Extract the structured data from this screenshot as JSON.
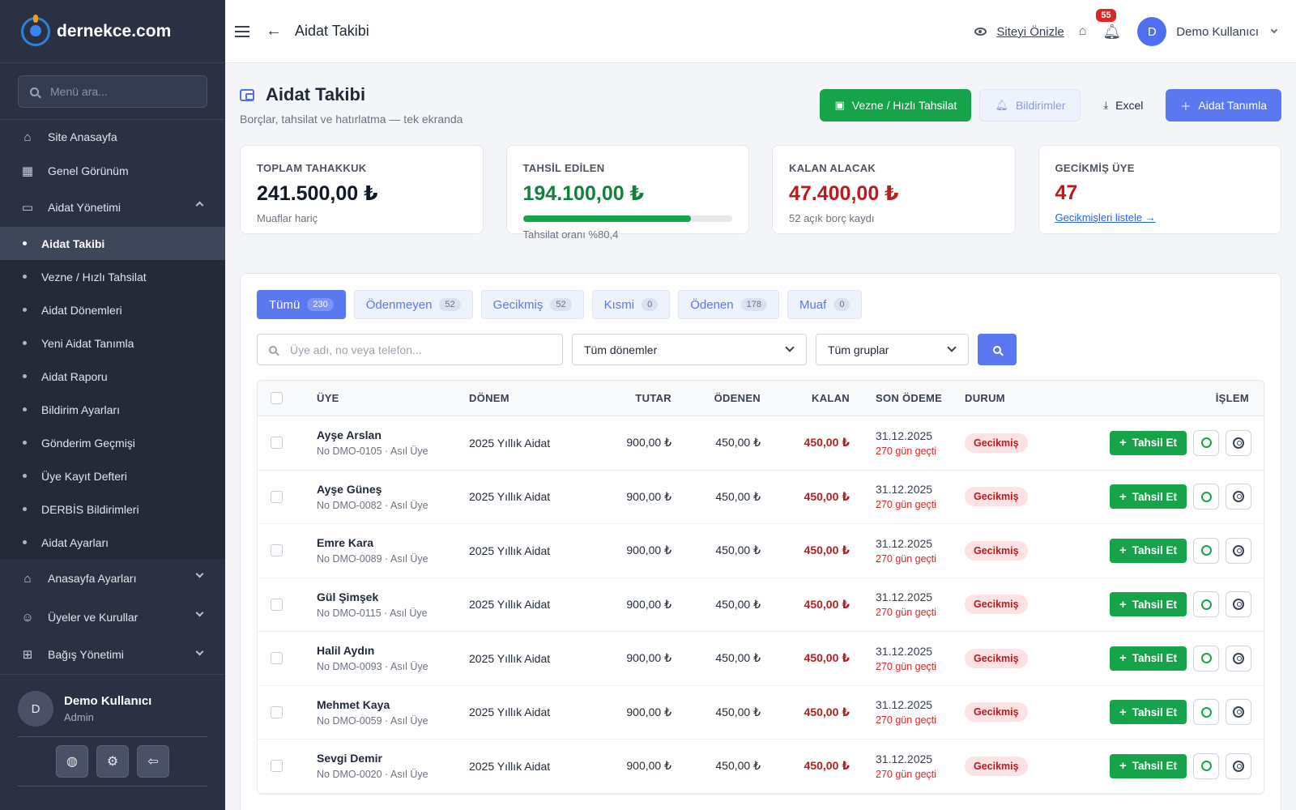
{
  "brand": {
    "name": "dernekce.com"
  },
  "sidebar": {
    "search_placeholder": "Menü ara...",
    "items": [
      {
        "label": "Site Anasayfa",
        "icon": "home-icon"
      },
      {
        "label": "Genel Görünüm",
        "icon": "grid-icon"
      },
      {
        "label": "Aidat Yönetimi",
        "icon": "wallet-icon"
      }
    ],
    "sub_items": [
      {
        "label": "Aidat Takibi",
        "active": true
      },
      {
        "label": "Vezne / Hızlı Tahsilat"
      },
      {
        "label": "Aidat Dönemleri"
      },
      {
        "label": "Yeni Aidat Tanımla"
      },
      {
        "label": "Aidat Raporu"
      },
      {
        "label": "Bildirim Ayarları"
      },
      {
        "label": "Gönderim Geçmişi"
      },
      {
        "label": "Üye Kayıt Defteri"
      },
      {
        "label": "DERBİS Bildirimleri"
      },
      {
        "label": "Aidat Ayarları"
      }
    ],
    "bottom_items": [
      {
        "label": "Anasayfa Ayarları",
        "icon": "home-icon"
      },
      {
        "label": "Üyeler ve Kurullar",
        "icon": "users-icon"
      },
      {
        "label": "Bağış Yönetimi",
        "icon": "gift-icon"
      }
    ],
    "user": {
      "avatar": "D",
      "name": "Demo Kullanıcı",
      "role": "Admin"
    }
  },
  "topbar": {
    "title": "Aidat Takibi",
    "preview_label": "Siteyi Önizle",
    "notification_count": "55",
    "avatar": "D",
    "user_name": "Demo Kullanıcı"
  },
  "page": {
    "title": "Aidat Takibi",
    "subtitle": "Borçlar, tahsilat ve hatırlatma — tek ekranda",
    "actions": {
      "vezne": "Vezne / Hızlı Tahsilat",
      "bildirimler": "Bildirimler",
      "excel": "Excel",
      "tanimla": "Aidat Tanımla"
    }
  },
  "stats": {
    "toplam": {
      "label": "TOPLAM TAHAKKUK",
      "value": "241.500,00 ₺",
      "note": "Muaflar hariç"
    },
    "tahsil": {
      "label": "TAHSİL EDİLEN",
      "value": "194.100,00 ₺",
      "note": "Tahsilat oranı %80,4",
      "rate": 0.804
    },
    "kalan": {
      "label": "KALAN ALACAK",
      "value": "47.400,00 ₺",
      "note": "52 açık borç kaydı"
    },
    "gecikmis": {
      "label": "GECİKMİŞ ÜYE",
      "value": "47",
      "link": "Gecikmişleri listele →"
    }
  },
  "tabs": [
    {
      "label": "Tümü",
      "count": "230",
      "active": true
    },
    {
      "label": "Ödenmeyen",
      "count": "52"
    },
    {
      "label": "Gecikmiş",
      "count": "52"
    },
    {
      "label": "Kısmi",
      "count": "0"
    },
    {
      "label": "Ödenen",
      "count": "178"
    },
    {
      "label": "Muaf",
      "count": "0"
    }
  ],
  "filters": {
    "search_placeholder": "Üye adı, no veya telefon...",
    "period": "Tüm dönemler",
    "group": "Tüm gruplar"
  },
  "table": {
    "headers": {
      "uye": "ÜYE",
      "donem": "DÖNEM",
      "tutar": "TUTAR",
      "odenen": "ÖDENEN",
      "kalan": "KALAN",
      "son": "SON ÖDEME",
      "durum": "DURUM",
      "islem": "İŞLEM"
    },
    "action_label": "Tahsil Et",
    "rows": [
      {
        "name": "Ayşe Arslan",
        "meta": "No DMO-0105 · Asıl Üye",
        "donem": "2025 Yıllık Aidat",
        "tutar": "900,00 ₺",
        "odenen": "450,00 ₺",
        "kalan": "450,00 ₺",
        "son": "31.12.2025",
        "late": "270 gün geçti",
        "durum": "Gecikmiş"
      },
      {
        "name": "Ayşe Güneş",
        "meta": "No DMO-0082 · Asıl Üye",
        "donem": "2025 Yıllık Aidat",
        "tutar": "900,00 ₺",
        "odenen": "450,00 ₺",
        "kalan": "450,00 ₺",
        "son": "31.12.2025",
        "late": "270 gün geçti",
        "durum": "Gecikmiş"
      },
      {
        "name": "Emre Kara",
        "meta": "No DMO-0089 · Asıl Üye",
        "donem": "2025 Yıllık Aidat",
        "tutar": "900,00 ₺",
        "odenen": "450,00 ₺",
        "kalan": "450,00 ₺",
        "son": "31.12.2025",
        "late": "270 gün geçti",
        "durum": "Gecikmiş"
      },
      {
        "name": "Gül Şimşek",
        "meta": "No DMO-0115 · Asıl Üye",
        "donem": "2025 Yıllık Aidat",
        "tutar": "900,00 ₺",
        "odenen": "450,00 ₺",
        "kalan": "450,00 ₺",
        "son": "31.12.2025",
        "late": "270 gün geçti",
        "durum": "Gecikmiş"
      },
      {
        "name": "Halil Aydın",
        "meta": "No DMO-0093 · Asıl Üye",
        "donem": "2025 Yıllık Aidat",
        "tutar": "900,00 ₺",
        "odenen": "450,00 ₺",
        "kalan": "450,00 ₺",
        "son": "31.12.2025",
        "late": "270 gün geçti",
        "durum": "Gecikmiş"
      },
      {
        "name": "Mehmet Kaya",
        "meta": "No DMO-0059 · Asıl Üye",
        "donem": "2025 Yıllık Aidat",
        "tutar": "900,00 ₺",
        "odenen": "450,00 ₺",
        "kalan": "450,00 ₺",
        "son": "31.12.2025",
        "late": "270 gün geçti",
        "durum": "Gecikmiş"
      },
      {
        "name": "Sevgi Demir",
        "meta": "No DMO-0020 · Asıl Üye",
        "donem": "2025 Yıllık Aidat",
        "tutar": "900,00 ₺",
        "odenen": "450,00 ₺",
        "kalan": "450,00 ₺",
        "son": "31.12.2025",
        "late": "270 gün geçti",
        "durum": "Gecikmiş"
      }
    ]
  }
}
